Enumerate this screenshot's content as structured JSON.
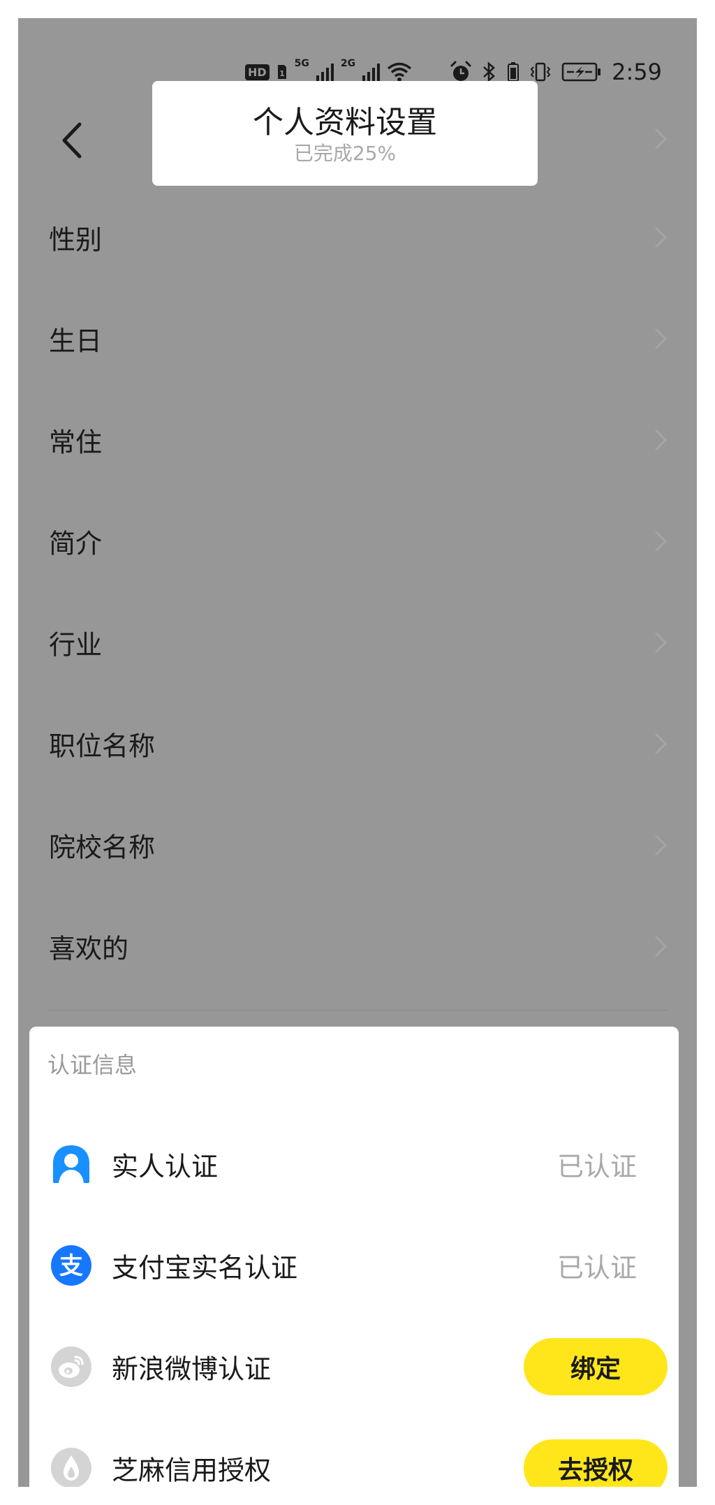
{
  "colors": {
    "overlay_background": "#979797",
    "card_background": "#ffffff",
    "text_primary": "#1a1a1a",
    "text_muted": "#a8a8a8",
    "accent_yellow": "#FFE61B",
    "alipay_blue": "#1677FF",
    "verify_blue": "#1890FF",
    "disabled_gray": "#d4d4d4"
  },
  "status_bar": {
    "hd": "HD",
    "sim1_network": "5G",
    "sim2_network": "2G",
    "time": "2:59"
  },
  "header": {
    "title": "个人资料设置",
    "subtitle": "已完成25%"
  },
  "profile_items": [
    {
      "label": "性别"
    },
    {
      "label": "生日"
    },
    {
      "label": "常住"
    },
    {
      "label": "简介"
    },
    {
      "label": "行业"
    },
    {
      "label": "职位名称"
    },
    {
      "label": "院校名称"
    },
    {
      "label": "喜欢的"
    }
  ],
  "auth": {
    "section_title": "认证信息",
    "items": [
      {
        "label": "实人认证",
        "status": "已认证",
        "icon": "person-verify-icon"
      },
      {
        "label": "支付宝实名认证",
        "status": "已认证",
        "icon": "alipay-icon"
      },
      {
        "label": "新浪微博认证",
        "button": "绑定",
        "icon": "weibo-icon"
      },
      {
        "label": "芝麻信用授权",
        "button": "去授权",
        "icon": "sesame-credit-icon"
      }
    ]
  }
}
